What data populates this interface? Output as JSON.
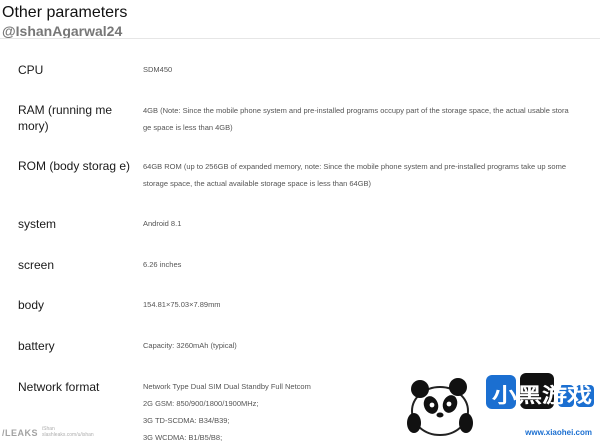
{
  "header": {
    "title": "Other parameters",
    "handle": "@IshanAgarwal24"
  },
  "params": [
    {
      "label": "CPU",
      "value_lines": [
        "SDM450"
      ]
    },
    {
      "label": "RAM (running me mory)",
      "value_lines": [
        "4GB (Note: Since the mobile phone system and pre-installed programs occupy part of the storage space, the actual usable stora",
        "ge space is less than 4GB)"
      ]
    },
    {
      "label": "ROM (body storag e)",
      "value_lines": [
        "64GB ROM (up to 256GB of expanded memory, note: Since the mobile phone system and pre-installed programs take up some",
        "storage space, the actual available storage space is less than 64GB)"
      ]
    },
    {
      "label": "system",
      "value_lines": [
        "Android 8.1"
      ]
    },
    {
      "label": "screen",
      "value_lines": [
        "6.26 inches"
      ]
    },
    {
      "label": "body",
      "value_lines": [
        "154.81×75.03×7.89mm"
      ]
    },
    {
      "label": "battery",
      "value_lines": [
        "Capacity: 3260mAh (typical)"
      ]
    },
    {
      "label": "Network format",
      "value_lines": [
        "Network Type Dual SIM Dual Standby Full Netcom",
        "2G GSM: 850/900/1800/1900MHz;",
        "3G TD-SCDMA: B34/B39;",
        "3G WCDMA: B1/B5/B8;"
      ]
    }
  ],
  "watermarks": {
    "left_brand": "/LEAKS",
    "left_small_1": "iShan",
    "left_small_2": "slashleaks.com/u/ishan",
    "right_site": "www.xiaohei.com",
    "right_logo_text": "小黑游戏"
  }
}
